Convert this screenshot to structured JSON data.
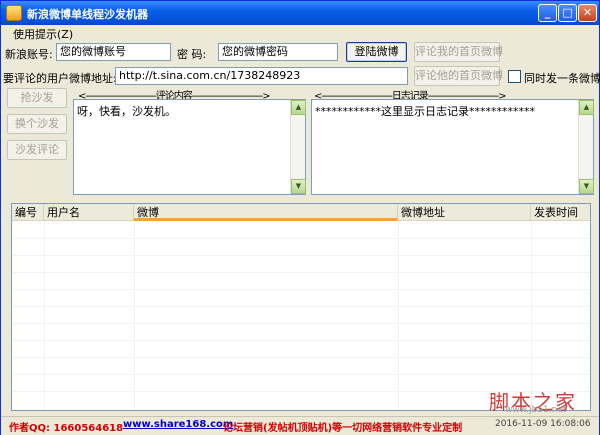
{
  "window": {
    "title": "新浪微博单线程沙发机器",
    "min": "_",
    "max": "□",
    "close": "✕"
  },
  "menu": {
    "help": "使用提示(Z)"
  },
  "login": {
    "account_label": "新浪账号:",
    "account_value": "您的微博账号",
    "password_label": "密  码:",
    "password_value": "您的微博密码",
    "login_button": "登陆微博",
    "comment_my_button": "评论我的首页微博"
  },
  "target": {
    "label": "要评论的用户微博地址:",
    "url": "http://t.sina.com.cn/1738248923",
    "comment_his_button": "评论他的首页微博",
    "also_post_label": "同时发一条微博"
  },
  "side_buttons": {
    "grab": "抢沙发",
    "switch": "换个沙发",
    "sofa_comment": "沙发评论"
  },
  "comment": {
    "caption": "<---------------------------评论内容--------------------------->",
    "text": "呀，快看，沙发机。"
  },
  "log": {
    "caption": "<---------------------------日志记录--------------------------->",
    "text": "************这里显示日志记录************"
  },
  "table": {
    "columns": [
      "编号",
      "用户名",
      "微博",
      "微博地址",
      "发表时间"
    ]
  },
  "status": {
    "qq": "作者QQ: 1660564618",
    "site": "www.share168.com",
    "ad": "论坛营销(发帖机顶贴机)等一切网络营销软件专业定制",
    "datetime": "2016-11-09 16:08:06"
  },
  "watermark": {
    "main": "脚本之家",
    "sub": "www.jb51.net"
  },
  "colors": {
    "title_blue": "#0a5fe8",
    "status_red": "#d40000",
    "status_blue": "#0000cc",
    "header_accent": "#f9a13a"
  }
}
